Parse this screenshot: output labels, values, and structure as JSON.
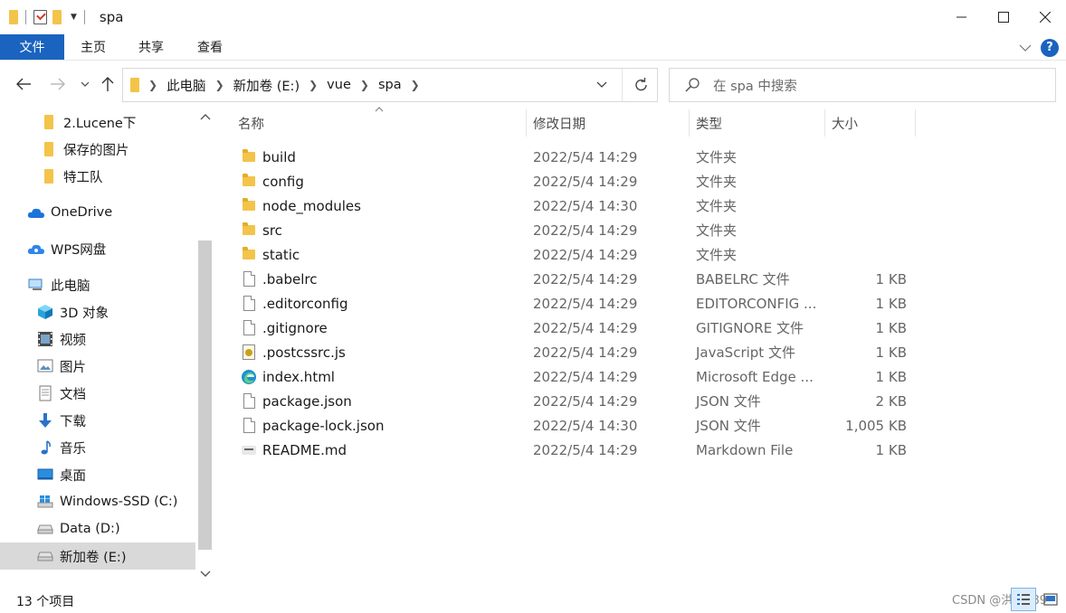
{
  "window": {
    "title": "spa"
  },
  "ribbon": {
    "file_label": "文件",
    "tabs": [
      "主页",
      "共享",
      "查看"
    ],
    "help_label": "?"
  },
  "address": {
    "crumbs": [
      "此电脑",
      "新加卷 (E:)",
      "vue",
      "spa"
    ]
  },
  "search": {
    "placeholder": "在 spa 中搜索"
  },
  "nav": {
    "items": [
      {
        "label": "2.Lucene下",
        "icon": "folder-icon"
      },
      {
        "label": "保存的图片",
        "icon": "folder-icon"
      },
      {
        "label": "特工队",
        "icon": "folder-icon"
      },
      {
        "label": "OneDrive",
        "icon": "cloud-icon"
      },
      {
        "label": "WPS网盘",
        "icon": "cloud-icon"
      },
      {
        "label": "此电脑",
        "icon": "computer-icon"
      },
      {
        "label": "3D 对象",
        "icon": "cube-icon"
      },
      {
        "label": "视频",
        "icon": "video-icon"
      },
      {
        "label": "图片",
        "icon": "picture-icon"
      },
      {
        "label": "文档",
        "icon": "document-icon"
      },
      {
        "label": "下载",
        "icon": "download-icon"
      },
      {
        "label": "音乐",
        "icon": "music-icon"
      },
      {
        "label": "桌面",
        "icon": "desktop-icon"
      },
      {
        "label": "Windows-SSD (C:)",
        "icon": "windows-drive-icon"
      },
      {
        "label": "Data (D:)",
        "icon": "drive-icon"
      },
      {
        "label": "新加卷 (E:)",
        "icon": "drive-icon"
      }
    ]
  },
  "columns": {
    "name": "名称",
    "modified": "修改日期",
    "type": "类型",
    "size": "大小"
  },
  "files": [
    {
      "name": "build",
      "modified": "2022/5/4 14:29",
      "type": "文件夹",
      "size": "",
      "icon": "folder-icon"
    },
    {
      "name": "config",
      "modified": "2022/5/4 14:29",
      "type": "文件夹",
      "size": "",
      "icon": "folder-icon"
    },
    {
      "name": "node_modules",
      "modified": "2022/5/4 14:30",
      "type": "文件夹",
      "size": "",
      "icon": "folder-icon"
    },
    {
      "name": "src",
      "modified": "2022/5/4 14:29",
      "type": "文件夹",
      "size": "",
      "icon": "folder-icon"
    },
    {
      "name": "static",
      "modified": "2022/5/4 14:29",
      "type": "文件夹",
      "size": "",
      "icon": "folder-icon"
    },
    {
      "name": ".babelrc",
      "modified": "2022/5/4 14:29",
      "type": "BABELRC 文件",
      "size": "1 KB",
      "icon": "file-icon"
    },
    {
      "name": ".editorconfig",
      "modified": "2022/5/4 14:29",
      "type": "EDITORCONFIG ...",
      "size": "1 KB",
      "icon": "file-icon"
    },
    {
      "name": ".gitignore",
      "modified": "2022/5/4 14:29",
      "type": "GITIGNORE 文件",
      "size": "1 KB",
      "icon": "file-icon"
    },
    {
      "name": ".postcssrc.js",
      "modified": "2022/5/4 14:29",
      "type": "JavaScript 文件",
      "size": "1 KB",
      "icon": "javascript-file-icon"
    },
    {
      "name": "index.html",
      "modified": "2022/5/4 14:29",
      "type": "Microsoft Edge ...",
      "size": "1 KB",
      "icon": "edge-icon"
    },
    {
      "name": "package.json",
      "modified": "2022/5/4 14:29",
      "type": "JSON 文件",
      "size": "2 KB",
      "icon": "file-icon"
    },
    {
      "name": "package-lock.json",
      "modified": "2022/5/4 14:30",
      "type": "JSON 文件",
      "size": "1,005 KB",
      "icon": "file-icon"
    },
    {
      "name": "README.md",
      "modified": "2022/5/4 14:29",
      "type": "Markdown File",
      "size": "1 KB",
      "icon": "markdown-icon"
    }
  ],
  "status": {
    "item_count": "13 个项目",
    "watermark": "CSDN @洪荒289"
  },
  "colors": {
    "file_tab": "#1a63bf",
    "selected_nav": "#d9d9d9",
    "folder": "#f3c44a"
  }
}
